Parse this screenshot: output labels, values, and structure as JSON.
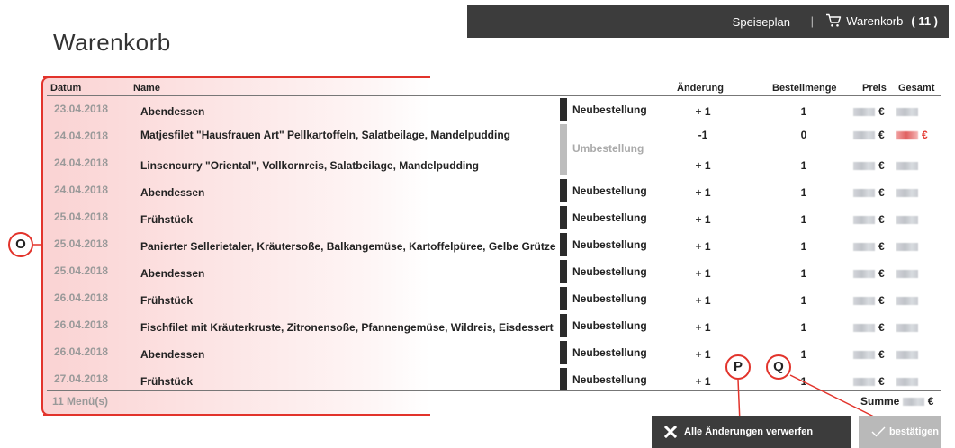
{
  "header": {
    "nav_speiseplan": "Speiseplan",
    "separator": "|",
    "cart_label": "Warenkorb",
    "cart_count": "( 11 )"
  },
  "page_title": "Warenkorb",
  "columns": {
    "datum": "Datum",
    "name": "Name",
    "aenderung": "Änderung",
    "bestellmenge": "Bestellmenge",
    "preis": "Preis",
    "gesamt": "Gesamt"
  },
  "currency": "€",
  "rows": [
    {
      "date": "23.04.2018",
      "name": "Abendessen",
      "status": "Neubestellung",
      "change": "+ 1",
      "qty": "1"
    },
    {
      "date": "24.04.2018",
      "name": "Matjesfilet \"Hausfrauen Art\" Pellkartoffeln, Salatbeilage, Mandelpudding",
      "status": "",
      "change": "-1",
      "qty": "0"
    },
    {
      "date": "24.04.2018",
      "name": "Linsencurry \"Oriental\", Vollkornreis, Salatbeilage, Mandelpudding",
      "status": "",
      "change": "+ 1",
      "qty": "1"
    },
    {
      "date": "24.04.2018",
      "name": "Abendessen",
      "status": "Neubestellung",
      "change": "+ 1",
      "qty": "1"
    },
    {
      "date": "25.04.2018",
      "name": "Frühstück",
      "status": "Neubestellung",
      "change": "+ 1",
      "qty": "1"
    },
    {
      "date": "25.04.2018",
      "name": "Panierter Sellerietaler, Kräutersoße, Balkangemüse, Kartoffelpüree, Gelbe Grütze",
      "status": "Neubestellung",
      "change": "+ 1",
      "qty": "1"
    },
    {
      "date": "25.04.2018",
      "name": "Abendessen",
      "status": "Neubestellung",
      "change": "+ 1",
      "qty": "1"
    },
    {
      "date": "26.04.2018",
      "name": "Frühstück",
      "status": "Neubestellung",
      "change": "+ 1",
      "qty": "1"
    },
    {
      "date": "26.04.2018",
      "name": "Fischfilet mit Kräuterkruste, Zitronensoße, Pfannengemüse, Wildreis, Eisdessert",
      "status": "Neubestellung",
      "change": "+ 1",
      "qty": "1"
    },
    {
      "date": "26.04.2018",
      "name": "Abendessen",
      "status": "Neubestellung",
      "change": "+ 1",
      "qty": "1"
    },
    {
      "date": "27.04.2018",
      "name": "Frühstück",
      "status": "Neubestellung",
      "change": "+ 1",
      "qty": "1"
    }
  ],
  "group_status": "Umbestellung",
  "footer": {
    "menus": "11 Menü(s)",
    "sum_label": "Summe"
  },
  "buttons": {
    "discard": "Alle Änderungen verwerfen",
    "confirm": "bestätigen"
  },
  "callouts": {
    "o": "O",
    "p": "P",
    "q": "Q"
  },
  "colors": {
    "topbar": "#3c3c3c",
    "annotation": "#e2332b",
    "status_bar": "#2b2b2b",
    "group_bar": "#bdbdbd",
    "confirm_button": "#b9b9b9"
  },
  "icons": {
    "cart": "cart-icon",
    "discard": "close-icon",
    "confirm": "checkmark-icon"
  }
}
